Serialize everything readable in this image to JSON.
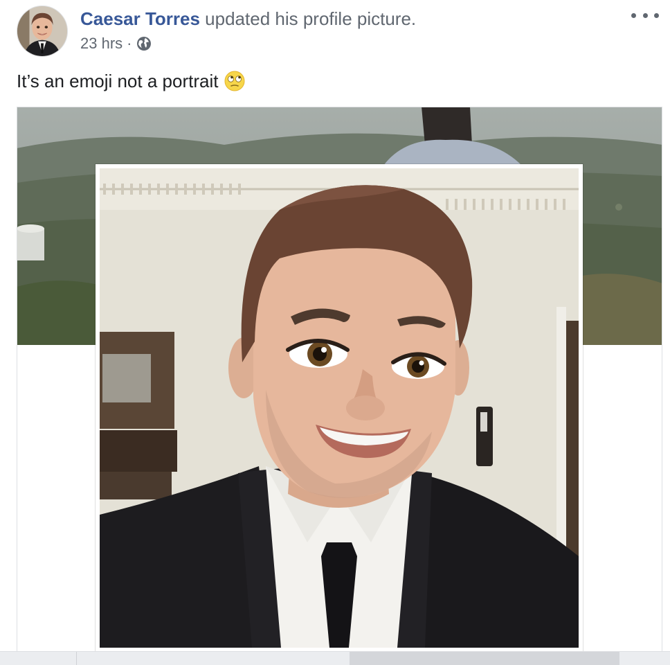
{
  "header": {
    "author_name": "Caesar Torres",
    "action_text": " updated his profile picture.",
    "timestamp": "23 hrs",
    "separator": " ·",
    "privacy_icon": "globe-icon",
    "more_icon": "more-options-icon"
  },
  "post": {
    "text": "It’s an emoji not a portrait",
    "emoji_icon": "face-with-rolling-eyes-icon"
  },
  "colors": {
    "author_link": "#385898",
    "secondary_text": "#606770",
    "body_text": "#1c1e21"
  }
}
